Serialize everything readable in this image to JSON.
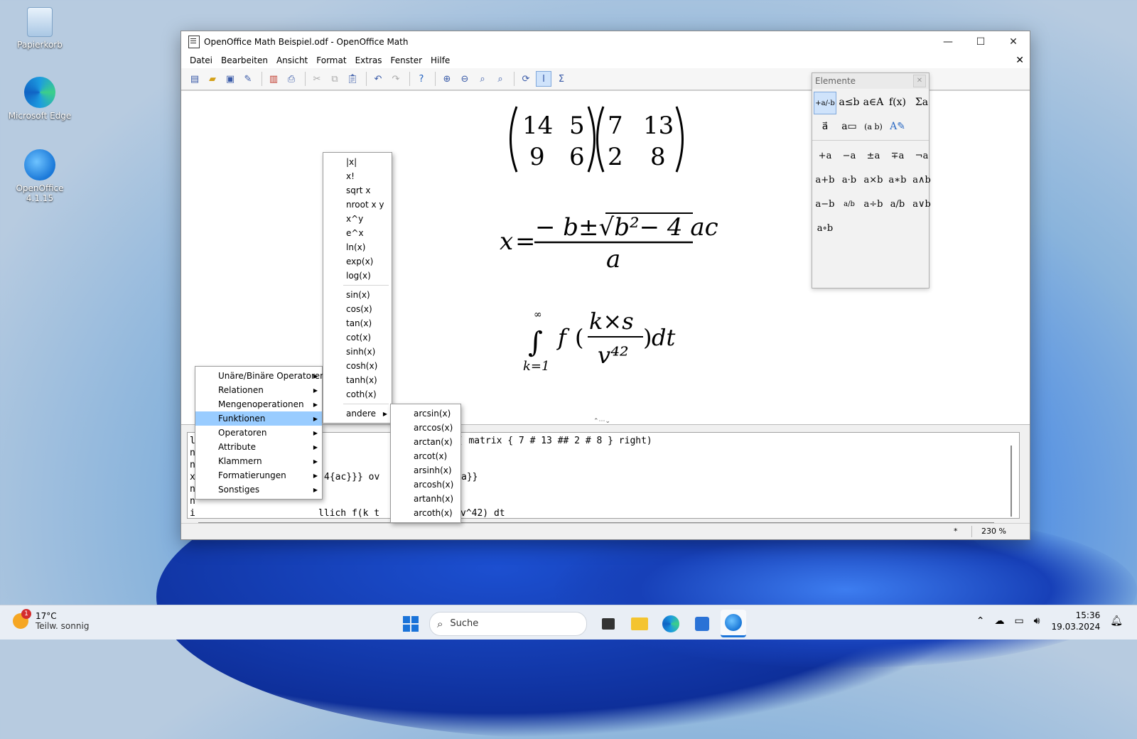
{
  "desktop": {
    "icons": [
      {
        "label": "Papierkorb"
      },
      {
        "label": "Microsoft Edge"
      },
      {
        "label": "OpenOffice 4.1.15"
      }
    ]
  },
  "window": {
    "title": "OpenOffice Math Beispiel.odf - OpenOffice Math",
    "minimize": "—",
    "maximize": "☐",
    "close": "✕",
    "close_doc": "✕"
  },
  "menubar": [
    "Datei",
    "Bearbeiten",
    "Ansicht",
    "Format",
    "Extras",
    "Fenster",
    "Hilfe"
  ],
  "formulas": {
    "m1": [
      "14",
      "5",
      "9",
      "6"
    ],
    "m2": [
      "7",
      "13",
      "2",
      "8"
    ],
    "quad_x": "x",
    "quad_num": "− b±√b²− 4 ac",
    "quad_den": "a",
    "int_sym": "∫",
    "int_upper": "∞",
    "int_lower": "k=1",
    "int_f": "f",
    "int_num": "k×s",
    "int_den": "v⁴²",
    "int_dt": "dt"
  },
  "command": {
    "line1_prefix": "l",
    "line1_tail": "t( matrix { 7 # 13 ## 2 # 8 } right)",
    "line2_prefix": "n",
    "line3_prefix": "n",
    "line4_prefix": "x",
    "line4_mid": "4{ac}}} ov",
    "line4_tail": "a}}",
    "line5_prefix": "n",
    "line6_prefix": "n",
    "line7_prefix": "i",
    "line7_mid": "llich f(k t",
    "line7_tail": "v^42) dt"
  },
  "status": {
    "modified": "*",
    "zoom": "230 %"
  },
  "elements_panel": {
    "title": "Elemente",
    "categories": [
      "+a/-b",
      "a≤b",
      "a∈A",
      "f(x)",
      "Σa",
      "a⃗",
      "a▭",
      "(a b)",
      "A✎"
    ],
    "symbols": [
      "+a",
      "−a",
      "±a",
      "∓a",
      "¬a",
      "a+b",
      "a·b",
      "a×b",
      "a∗b",
      "a∧b",
      "a−b",
      "a/b",
      "a÷b",
      "a/b",
      "a∨b",
      "a∘b"
    ]
  },
  "context_menu": {
    "items": [
      "Unäre/Binäre Operatoren",
      "Relationen",
      "Mengenoperationen",
      "Funktionen",
      "Operatoren",
      "Attribute",
      "Klammern",
      "Formatierungen",
      "Sonstiges"
    ],
    "highlighted": "Funktionen"
  },
  "functions_menu": {
    "items": [
      "|x|",
      "x!",
      "sqrt x",
      "nroot x y",
      "x^y",
      "e^x",
      "ln(x)",
      "exp(x)",
      "log(x)",
      "sin(x)",
      "cos(x)",
      "tan(x)",
      "cot(x)",
      "sinh(x)",
      "cosh(x)",
      "tanh(x)",
      "coth(x)"
    ],
    "more": "andere"
  },
  "other_menu": {
    "items": [
      "arcsin(x)",
      "arccos(x)",
      "arctan(x)",
      "arcot(x)",
      "arsinh(x)",
      "arcosh(x)",
      "artanh(x)",
      "arcoth(x)"
    ]
  },
  "taskbar": {
    "weather_temp": "17°C",
    "weather_desc": "Teilw. sonnig",
    "weather_badge": "1",
    "search_placeholder": "Suche",
    "time": "15:36",
    "date": "19.03.2024"
  }
}
